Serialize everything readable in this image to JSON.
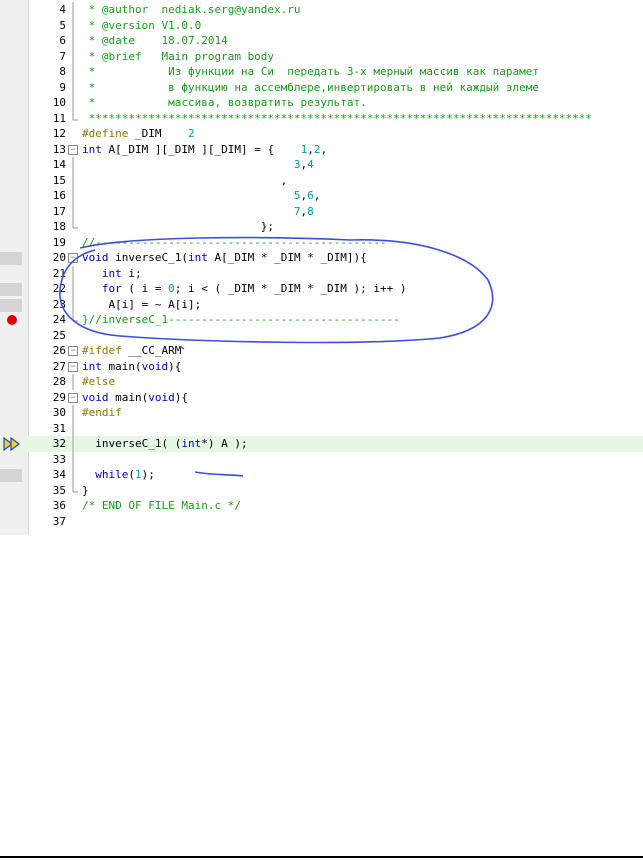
{
  "editor": {
    "lines": [
      {
        "num": "4",
        "fold": "line",
        "mark": null,
        "tokens": [
          {
            "t": " * @author  nediak.serg@yandex.ru",
            "c": "comment"
          }
        ]
      },
      {
        "num": "5",
        "fold": "line",
        "mark": null,
        "tokens": [
          {
            "t": " * @version V1.0.0",
            "c": "comment"
          }
        ]
      },
      {
        "num": "6",
        "fold": "line",
        "mark": null,
        "tokens": [
          {
            "t": " * @date    18.07.2014",
            "c": "comment"
          }
        ]
      },
      {
        "num": "7",
        "fold": "line",
        "mark": null,
        "tokens": [
          {
            "t": " * @brief   Main program body",
            "c": "comment"
          }
        ]
      },
      {
        "num": "8",
        "fold": "line",
        "mark": null,
        "tokens": [
          {
            "t": " *           Из функции на Си  передать 3-х мерный массив как парамет",
            "c": "comment"
          }
        ]
      },
      {
        "num": "9",
        "fold": "line",
        "mark": null,
        "tokens": [
          {
            "t": " *           в функцию на ассемблере,инвертировать в ней каждый элеме",
            "c": "comment"
          }
        ]
      },
      {
        "num": "10",
        "fold": "line",
        "mark": null,
        "tokens": [
          {
            "t": " *           массива, возвратить результат.",
            "c": "comment"
          }
        ]
      },
      {
        "num": "11",
        "fold": "end",
        "mark": null,
        "tokens": [
          {
            "t": " ****************************************************************************",
            "c": "comment"
          }
        ]
      },
      {
        "num": "12",
        "fold": "",
        "mark": null,
        "tokens": [
          {
            "t": "#define",
            "c": "pp"
          },
          {
            "t": " _DIM    ",
            "c": "plain"
          },
          {
            "t": "2",
            "c": "num"
          }
        ]
      },
      {
        "num": "13",
        "fold": "box",
        "mark": null,
        "tokens": [
          {
            "t": "int",
            "c": "kw"
          },
          {
            "t": " A[_DIM ][_DIM ][_DIM] = {    ",
            "c": "plain"
          },
          {
            "t": "1",
            "c": "num"
          },
          {
            "t": ",",
            "c": "plain"
          },
          {
            "t": "2",
            "c": "num"
          },
          {
            "t": ",",
            "c": "plain"
          }
        ]
      },
      {
        "num": "14",
        "fold": "line",
        "mark": null,
        "tokens": [
          {
            "t": "                                ",
            "c": "plain"
          },
          {
            "t": "3",
            "c": "num"
          },
          {
            "t": ",",
            "c": "plain"
          },
          {
            "t": "4",
            "c": "num"
          }
        ]
      },
      {
        "num": "15",
        "fold": "line",
        "mark": null,
        "tokens": [
          {
            "t": "                              ,",
            "c": "plain"
          }
        ]
      },
      {
        "num": "16",
        "fold": "line",
        "mark": null,
        "tokens": [
          {
            "t": "                                ",
            "c": "plain"
          },
          {
            "t": "5",
            "c": "num"
          },
          {
            "t": ",",
            "c": "plain"
          },
          {
            "t": "6",
            "c": "num"
          },
          {
            "t": ",",
            "c": "plain"
          }
        ]
      },
      {
        "num": "17",
        "fold": "line",
        "mark": null,
        "tokens": [
          {
            "t": "                                ",
            "c": "plain"
          },
          {
            "t": "7",
            "c": "num"
          },
          {
            "t": ",",
            "c": "plain"
          },
          {
            "t": "8",
            "c": "num"
          }
        ]
      },
      {
        "num": "18",
        "fold": "end",
        "mark": null,
        "tokens": [
          {
            "t": "                           };",
            "c": "plain"
          }
        ]
      },
      {
        "num": "19",
        "fold": "",
        "mark": null,
        "tokens": [
          {
            "t": "//--------------------------------------------",
            "c": "comment"
          }
        ]
      },
      {
        "num": "20",
        "fold": "box",
        "mark": "gray",
        "tokens": [
          {
            "t": "void",
            "c": "kw"
          },
          {
            "t": " inverseC_1(",
            "c": "plain"
          },
          {
            "t": "int",
            "c": "kw"
          },
          {
            "t": " A[_DIM * _DIM * _DIM]){",
            "c": "plain"
          }
        ]
      },
      {
        "num": "21",
        "fold": "line",
        "mark": null,
        "tokens": [
          {
            "t": "   ",
            "c": "plain"
          },
          {
            "t": "int",
            "c": "kw"
          },
          {
            "t": " i;",
            "c": "plain"
          }
        ]
      },
      {
        "num": "22",
        "fold": "line",
        "mark": "gray",
        "tokens": [
          {
            "t": "   ",
            "c": "plain"
          },
          {
            "t": "for",
            "c": "kw"
          },
          {
            "t": " ( i = ",
            "c": "plain"
          },
          {
            "t": "0",
            "c": "num"
          },
          {
            "t": "; i < ( _DIM * _DIM * _DIM ); i++ )",
            "c": "plain"
          }
        ]
      },
      {
        "num": "23",
        "fold": "line",
        "mark": "gray",
        "tokens": [
          {
            "t": "    A[i] = ~ A[i];",
            "c": "plain"
          }
        ]
      },
      {
        "num": "24",
        "fold": "end",
        "mark": "bp",
        "tokens": [
          {
            "t": "}//inverseC_1-----------------------------------",
            "c": "comment"
          }
        ]
      },
      {
        "num": "25",
        "fold": "",
        "mark": null,
        "tokens": [
          {
            "t": "",
            "c": "plain"
          }
        ]
      },
      {
        "num": "26",
        "fold": "box",
        "mark": null,
        "tokens": [
          {
            "t": "#ifdef",
            "c": "pp"
          },
          {
            "t": " __CC_ARM",
            "c": "plain"
          }
        ]
      },
      {
        "num": "27",
        "fold": "box",
        "mark": null,
        "tokens": [
          {
            "t": "int",
            "c": "kw"
          },
          {
            "t": " main(",
            "c": "plain"
          },
          {
            "t": "void",
            "c": "kw"
          },
          {
            "t": "){",
            "c": "plain"
          }
        ]
      },
      {
        "num": "28",
        "fold": "line",
        "mark": null,
        "tokens": [
          {
            "t": "#else",
            "c": "pp"
          }
        ]
      },
      {
        "num": "29",
        "fold": "box",
        "mark": null,
        "tokens": [
          {
            "t": "void",
            "c": "kw"
          },
          {
            "t": " main(",
            "c": "plain"
          },
          {
            "t": "void",
            "c": "kw"
          },
          {
            "t": "){",
            "c": "plain"
          }
        ]
      },
      {
        "num": "30",
        "fold": "line",
        "mark": null,
        "tokens": [
          {
            "t": "#endif",
            "c": "pp"
          }
        ]
      },
      {
        "num": "31",
        "fold": "line",
        "mark": null,
        "tokens": [
          {
            "t": "",
            "c": "plain"
          }
        ]
      },
      {
        "num": "32",
        "fold": "line",
        "mark": "arrow",
        "current": true,
        "tokens": [
          {
            "t": "  inverseC_1( (",
            "c": "plain"
          },
          {
            "t": "int",
            "c": "kw"
          },
          {
            "t": "*) A );",
            "c": "plain"
          }
        ]
      },
      {
        "num": "33",
        "fold": "line",
        "mark": null,
        "tokens": [
          {
            "t": "",
            "c": "plain"
          }
        ]
      },
      {
        "num": "34",
        "fold": "line",
        "mark": "gray",
        "tokens": [
          {
            "t": "  ",
            "c": "plain"
          },
          {
            "t": "while",
            "c": "kw"
          },
          {
            "t": "(",
            "c": "plain"
          },
          {
            "t": "1",
            "c": "num"
          },
          {
            "t": ");",
            "c": "plain"
          }
        ]
      },
      {
        "num": "35",
        "fold": "end",
        "mark": null,
        "tokens": [
          {
            "t": "}",
            "c": "plain"
          }
        ]
      },
      {
        "num": "36",
        "fold": "",
        "mark": null,
        "tokens": [
          {
            "t": "/* END OF FILE Main.c */",
            "c": "comment"
          }
        ]
      },
      {
        "num": "37",
        "fold": "",
        "mark": null,
        "tokens": [
          {
            "t": "",
            "c": "plain"
          }
        ]
      }
    ]
  },
  "colors": {
    "comment": "#1a9a1a",
    "keyword": "#0000c0",
    "number": "#009aa6",
    "preprocessor": "#8a7a00",
    "annotation": "#3a4de0",
    "breakpoint": "#e00000",
    "current_line": "#e6f7e6"
  },
  "icons": {
    "breakpoint": "breakpoint-icon",
    "execution_pointer": "execution-arrow-icon",
    "fold_box": "fold-toggle-icon"
  }
}
